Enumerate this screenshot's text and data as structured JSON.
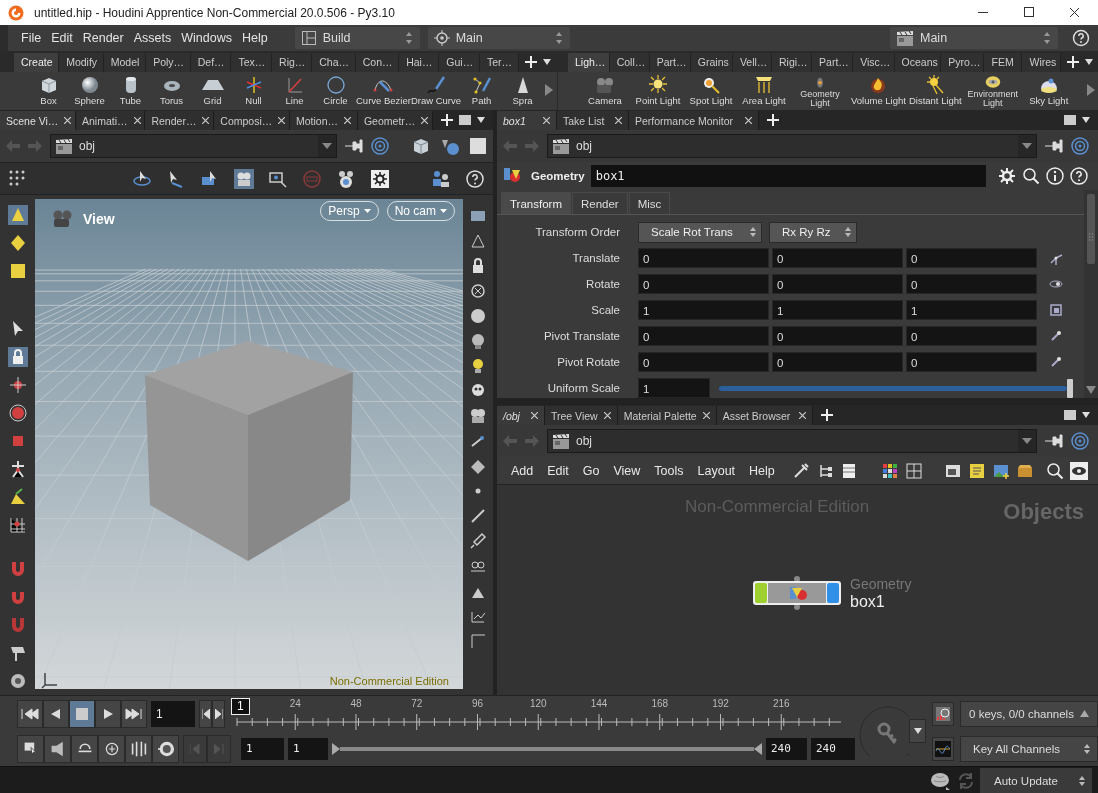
{
  "window": {
    "title": "untitled.hip - Houdini Apprentice Non-Commercial 20.0.506 - Py3.10"
  },
  "menu": [
    "File",
    "Edit",
    "Render",
    "Assets",
    "Windows",
    "Help"
  ],
  "desktop": "Build",
  "context": "Main",
  "right_context": "Main",
  "shelves": [
    {
      "tabs": [
        {
          "label": "Create",
          "selected": true
        },
        {
          "label": "Modify",
          "selected": false
        },
        {
          "label": "Model",
          "selected": false
        },
        {
          "label": "Poly…",
          "selected": false
        },
        {
          "label": "Def…",
          "selected": false
        },
        {
          "label": "Tex…",
          "selected": false
        },
        {
          "label": "Rig…",
          "selected": false
        },
        {
          "label": "Cha…",
          "selected": false
        },
        {
          "label": "Con…",
          "selected": false
        },
        {
          "label": "Hai…",
          "selected": false
        },
        {
          "label": "Gui…",
          "selected": false
        },
        {
          "label": "Ter…",
          "selected": false
        }
      ],
      "tools": [
        "Box",
        "Sphere",
        "Tube",
        "Torus",
        "Grid",
        "Null",
        "Line",
        "Circle",
        "Curve Bezier",
        "Draw Curve",
        "Path",
        "Spra"
      ]
    },
    {
      "tabs": [
        {
          "label": "Ligh…",
          "selected": true
        },
        {
          "label": "Coll…",
          "selected": false
        },
        {
          "label": "Part…",
          "selected": false
        },
        {
          "label": "Grains",
          "selected": false
        },
        {
          "label": "Vell…",
          "selected": false
        },
        {
          "label": "Rigi…",
          "selected": false
        },
        {
          "label": "Part…",
          "selected": false
        },
        {
          "label": "Visc…",
          "selected": false
        },
        {
          "label": "Oceans",
          "selected": false
        },
        {
          "label": "Pyro…",
          "selected": false
        },
        {
          "label": "FEM",
          "selected": false
        },
        {
          "label": "Wires",
          "selected": false
        }
      ],
      "tools": [
        "Camera",
        "Point Light",
        "Spot Light",
        "Area Light",
        "Geometry Light",
        "Volume Light",
        "Distant Light",
        "Environment Light",
        "Sky Light"
      ]
    }
  ],
  "scene_view": {
    "tabs": [
      {
        "label": "Scene Vi…",
        "selected": true,
        "kind": "plain"
      },
      {
        "label": "Animati…",
        "selected": false,
        "kind": "plain"
      },
      {
        "label": "Render…",
        "selected": false,
        "kind": "plain"
      },
      {
        "label": "Composi…",
        "selected": false,
        "kind": "plain"
      },
      {
        "label": "Motion…",
        "selected": false,
        "kind": "plain"
      },
      {
        "label": "Geometr…",
        "selected": false,
        "kind": "plain"
      }
    ],
    "path": "obj",
    "title": "View",
    "camera_menus": [
      "Persp",
      "No cam"
    ],
    "watermark": "Non-Commercial Edition"
  },
  "parameters": {
    "tabs": [
      {
        "label": "box1",
        "selected": true,
        "kind": "linked"
      },
      {
        "label": "Take List",
        "selected": false,
        "kind": "plain"
      },
      {
        "label": "Performance Monitor",
        "selected": false,
        "kind": "plain"
      }
    ],
    "path": "obj",
    "node_type": "Geometry",
    "node_name": "box1",
    "folders": [
      {
        "label": "Transform",
        "selected": true
      },
      {
        "label": "Render",
        "selected": false
      },
      {
        "label": "Misc",
        "selected": false
      }
    ],
    "transform_order": {
      "label": "Transform Order",
      "menus": [
        "Scale Rot Trans",
        "Rx Ry Rz"
      ]
    },
    "rows": [
      {
        "label": "Translate",
        "values": [
          "0",
          "0",
          "0"
        ]
      },
      {
        "label": "Rotate",
        "values": [
          "0",
          "0",
          "0"
        ]
      },
      {
        "label": "Scale",
        "values": [
          "1",
          "1",
          "1"
        ]
      },
      {
        "label": "Pivot Translate",
        "values": [
          "0",
          "0",
          "0"
        ]
      },
      {
        "label": "Pivot Rotate",
        "values": [
          "0",
          "0",
          "0"
        ]
      }
    ],
    "uniform_scale": {
      "label": "Uniform Scale",
      "value": "1",
      "level": 1.0
    }
  },
  "network": {
    "tabs": [
      {
        "label": "/obj",
        "selected": true,
        "kind": "linked"
      },
      {
        "label": "Tree View",
        "selected": false,
        "kind": "plain"
      },
      {
        "label": "Material Palette",
        "selected": false,
        "kind": "plain"
      },
      {
        "label": "Asset Browser",
        "selected": false,
        "kind": "plain"
      }
    ],
    "path": "obj",
    "menu": [
      "Add",
      "Edit",
      "Go",
      "View",
      "Tools",
      "Layout",
      "Help"
    ],
    "edition": "Non-Commercial Edition",
    "context_label": "Objects",
    "node": {
      "type": "Geometry",
      "name": "box1"
    }
  },
  "timeline": {
    "transport": [
      {
        "kind": "first",
        "selected": false
      },
      {
        "kind": "reverse",
        "selected": false
      },
      {
        "kind": "stop",
        "selected": true
      },
      {
        "kind": "play",
        "selected": false
      },
      {
        "kind": "last",
        "selected": false
      }
    ],
    "frame": "1",
    "marker": "1",
    "ticks": [
      "24",
      "48",
      "72",
      "96",
      "120",
      "144",
      "168",
      "192",
      "216"
    ],
    "start": "1",
    "range_start": "1",
    "range": {
      "level": 1.0
    },
    "range_end": "240",
    "end": "240",
    "keys": "0 keys, 0/0 channels",
    "key_mode": "Key All Channels"
  },
  "status": {
    "update_mode": "Auto Update"
  }
}
